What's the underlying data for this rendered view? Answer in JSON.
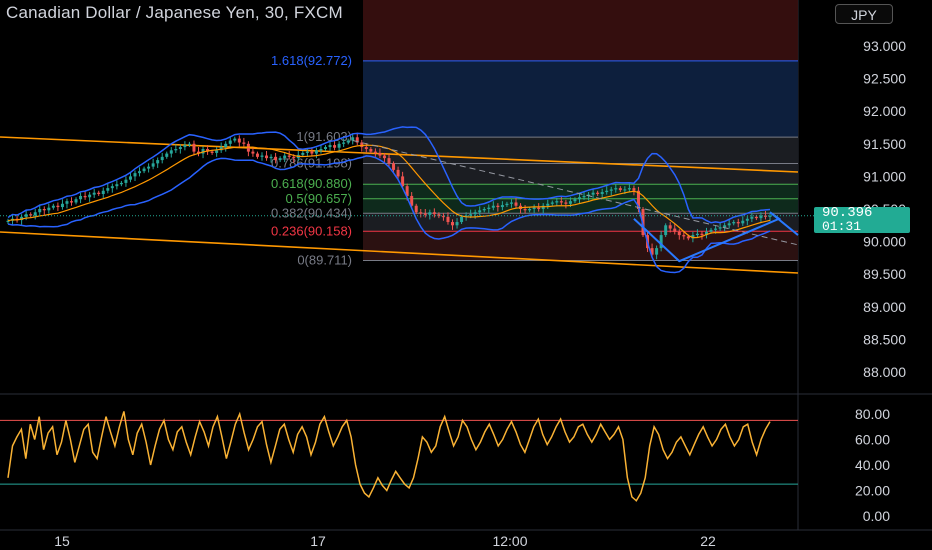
{
  "title": "Canadian Dollar / Japanese Yen, 30, FXCM",
  "currency_badge": "JPY",
  "last_price": "90.396",
  "countdown": "01:31",
  "colors": {
    "background": "#000000",
    "up": "#26a69a",
    "down": "#ef5350",
    "channel": "#ff9800",
    "bollinger": "#2962ff",
    "rsi": "#f9b234",
    "price_tag": "#22ab94"
  },
  "chart_data": [
    {
      "type": "candlestick",
      "title": "Canadian Dollar / Japanese Yen, 30, FXCM",
      "x_ticks": [
        "15",
        "17",
        "12:00",
        "22"
      ],
      "y_ticks": [
        "93.000",
        "92.500",
        "92.000",
        "91.500",
        "91.000",
        "90.500",
        "90.000",
        "89.500",
        "89.000",
        "88.500",
        "88.000"
      ],
      "ylim": [
        87.9,
        93.3
      ],
      "fibonacci": [
        {
          "label": "1.618(92.772)",
          "level": 1.618,
          "value": 92.772,
          "color": "#2962ff"
        },
        {
          "label": "1(91.603)",
          "level": 1,
          "value": 91.603,
          "color": "#787b86"
        },
        {
          "label": "0.786(91.198)",
          "level": 0.786,
          "value": 91.198,
          "color": "#787b86"
        },
        {
          "label": "0.618(90.880)",
          "level": 0.618,
          "value": 90.88,
          "color": "#4caf50"
        },
        {
          "label": "0.5(90.657)",
          "level": 0.5,
          "value": 90.657,
          "color": "#4caf50"
        },
        {
          "label": "0.382(90.434)",
          "level": 0.382,
          "value": 90.434,
          "color": "#787b86"
        },
        {
          "label": "0.236(90.158)",
          "level": 0.236,
          "value": 90.158,
          "color": "#f23645"
        },
        {
          "label": "0(89.711)",
          "level": 0,
          "value": 89.711,
          "color": "#787b86"
        }
      ],
      "close": [
        90.32,
        90.35,
        90.33,
        90.38,
        90.42,
        90.4,
        90.45,
        90.5,
        90.48,
        90.52,
        90.55,
        90.53,
        90.58,
        90.62,
        90.6,
        90.65,
        90.7,
        90.68,
        90.72,
        90.75,
        90.73,
        90.78,
        90.82,
        90.85,
        90.88,
        90.9,
        90.95,
        91.0,
        91.05,
        91.08,
        91.12,
        91.15,
        91.2,
        91.25,
        91.3,
        91.35,
        91.4,
        91.42,
        91.45,
        91.48,
        91.5,
        91.38,
        91.35,
        91.42,
        91.38,
        91.36,
        91.4,
        91.45,
        91.5,
        91.55,
        91.58,
        91.52,
        91.5,
        91.38,
        91.35,
        91.3,
        91.32,
        91.28,
        91.3,
        91.25,
        91.28,
        91.32,
        91.3,
        91.28,
        91.33,
        91.36,
        91.38,
        91.35,
        91.4,
        91.42,
        91.45,
        91.48,
        91.44,
        91.5,
        91.52,
        91.55,
        91.6,
        91.52,
        91.45,
        91.42,
        91.38,
        91.36,
        91.32,
        91.28,
        91.2,
        91.1,
        91.0,
        90.85,
        90.7,
        90.55,
        90.45,
        90.43,
        90.41,
        90.45,
        90.42,
        90.39,
        90.38,
        90.3,
        90.25,
        90.3,
        90.38,
        90.4,
        90.42,
        90.45,
        90.48,
        90.5,
        90.52,
        90.55,
        90.53,
        90.56,
        90.58,
        90.6,
        90.55,
        90.5,
        90.48,
        90.5,
        90.52,
        90.5,
        90.55,
        90.58,
        90.6,
        90.62,
        90.6,
        90.58,
        90.62,
        90.65,
        90.68,
        90.7,
        90.72,
        90.75,
        90.73,
        90.76,
        90.78,
        90.8,
        90.82,
        90.79,
        90.8,
        90.82,
        90.78,
        90.5,
        90.1,
        89.9,
        89.8,
        89.9,
        90.1,
        90.25,
        90.2,
        90.15,
        90.1,
        90.08,
        90.05,
        90.1,
        90.12,
        90.1,
        90.15,
        90.18,
        90.2,
        90.22,
        90.25,
        90.28,
        90.3,
        90.28,
        90.32,
        90.35,
        90.38,
        90.36,
        90.4,
        90.38,
        90.396
      ],
      "rsi": {
        "yticks": [
          "80.00",
          "60.00",
          "40.00",
          "20.00",
          "0.00"
        ],
        "upper_band": 75,
        "lower_band": 25,
        "values": [
          30,
          55,
          62,
          68,
          45,
          72,
          60,
          78,
          52,
          65,
          70,
          48,
          58,
          75,
          60,
          42,
          55,
          68,
          72,
          50,
          45,
          62,
          78,
          66,
          55,
          70,
          82,
          60,
          48,
          65,
          72,
          58,
          40,
          55,
          68,
          75,
          60,
          52,
          66,
          70,
          58,
          48,
          62,
          74,
          66,
          55,
          70,
          78,
          62,
          45,
          58,
          72,
          80,
          65,
          52,
          60,
          70,
          74,
          56,
          42,
          55,
          68,
          72,
          60,
          50,
          64,
          70,
          62,
          48,
          58,
          72,
          78,
          66,
          55,
          62,
          70,
          75,
          62,
          40,
          25,
          18,
          15,
          22,
          30,
          24,
          20,
          28,
          35,
          30,
          25,
          22,
          30,
          45,
          62,
          58,
          50,
          55,
          70,
          78,
          66,
          55,
          62,
          75,
          70,
          60,
          52,
          58,
          66,
          72,
          64,
          55,
          60,
          68,
          74,
          66,
          56,
          50,
          60,
          70,
          76,
          64,
          56,
          62,
          70,
          76,
          66,
          58,
          62,
          70,
          72,
          64,
          58,
          64,
          72,
          66,
          60,
          64,
          70,
          60,
          30,
          15,
          12,
          18,
          30,
          55,
          70,
          64,
          52,
          45,
          50,
          58,
          62,
          55,
          48,
          56,
          64,
          70,
          62,
          55,
          60,
          68,
          72,
          62,
          55,
          60,
          70,
          72,
          58,
          48,
          60,
          68,
          74
        ]
      }
    }
  ]
}
